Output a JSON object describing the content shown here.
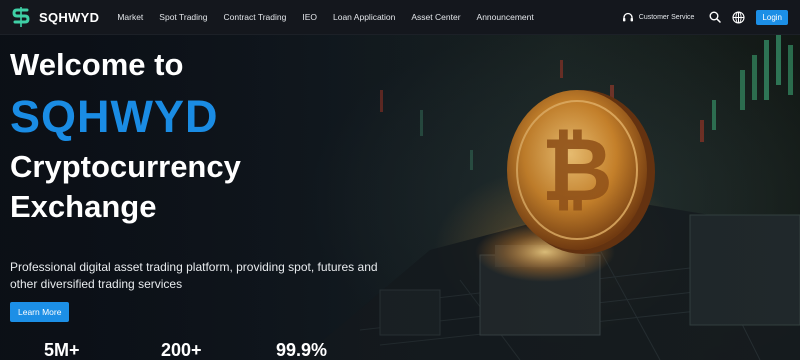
{
  "nav": {
    "logo_text": "SQHWYD",
    "items": [
      {
        "label": "Market"
      },
      {
        "label": "Spot Trading"
      },
      {
        "label": "Contract Trading"
      },
      {
        "label": "IEO"
      },
      {
        "label": "Loan Application"
      },
      {
        "label": "Asset Center"
      },
      {
        "label": "Announcement"
      }
    ],
    "customer_service": "Customer Service",
    "login": "Login",
    "icons": [
      "headset-icon",
      "search-icon",
      "language-icon"
    ]
  },
  "hero": {
    "line1": "Welcome to",
    "brand": "SQHWYD",
    "line3": "Cryptocurrency",
    "line4": "Exchange",
    "subtitle": "Professional digital asset trading platform, providing spot, futures and other diversified trading services",
    "cta": "Learn More",
    "stats": [
      {
        "value": "5M+"
      },
      {
        "value": "200+"
      },
      {
        "value": "99.9%"
      }
    ]
  },
  "colors": {
    "accent": "#1c8fe6",
    "brand_text": "#1a8ce4",
    "logo_green": "#3fd0a6",
    "nav_bg": "#14171d"
  }
}
